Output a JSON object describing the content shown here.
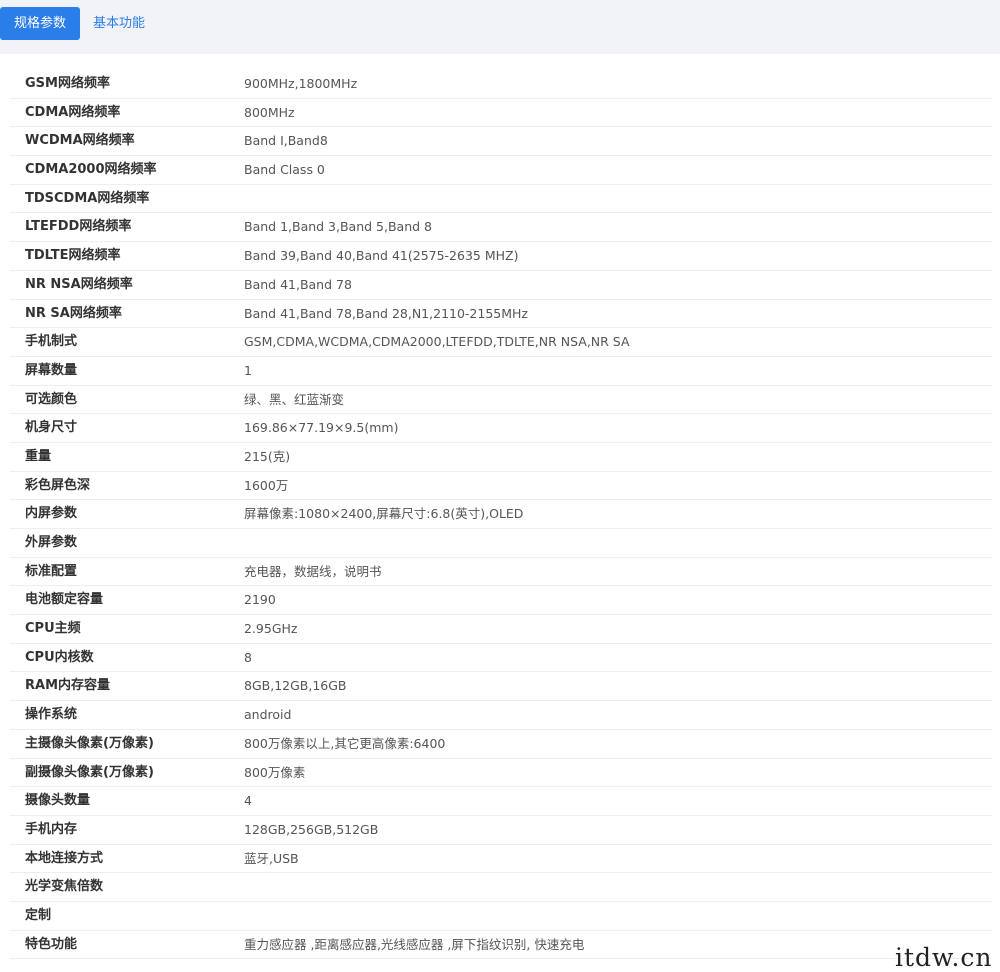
{
  "tabs": [
    {
      "label": "规格参数",
      "active": true
    },
    {
      "label": "基本功能",
      "active": false
    }
  ],
  "specs": [
    {
      "label": "GSM网络频率",
      "value": "900MHz,1800MHz"
    },
    {
      "label": "CDMA网络频率",
      "value": "800MHz"
    },
    {
      "label": "WCDMA网络频率",
      "value": "Band Ⅰ,Band8"
    },
    {
      "label": "CDMA2000网络频率",
      "value": "Band Class 0"
    },
    {
      "label": "TDSCDMA网络频率",
      "value": ""
    },
    {
      "label": "LTEFDD网络频率",
      "value": "Band 1,Band 3,Band 5,Band 8"
    },
    {
      "label": "TDLTE网络频率",
      "value": "Band 39,Band 40,Band 41(2575-2635 MHZ)"
    },
    {
      "label": "NR NSA网络频率",
      "value": "Band 41,Band 78"
    },
    {
      "label": "NR SA网络频率",
      "value": "Band 41,Band 78,Band 28,N1,2110-2155MHz"
    },
    {
      "label": "手机制式",
      "value": "GSM,CDMA,WCDMA,CDMA2000,LTEFDD,TDLTE,NR NSA,NR SA"
    },
    {
      "label": "屏幕数量",
      "value": "1"
    },
    {
      "label": "可选颜色",
      "value": "绿、黑、红蓝渐变"
    },
    {
      "label": "机身尺寸",
      "value": "169.86×77.19×9.5(mm)"
    },
    {
      "label": "重量",
      "value": "215(克)"
    },
    {
      "label": "彩色屏色深",
      "value": "1600万"
    },
    {
      "label": "内屏参数",
      "value": "屏幕像素:1080×2400,屏幕尺寸:6.8(英寸),OLED"
    },
    {
      "label": "外屏参数",
      "value": ""
    },
    {
      "label": "标准配置",
      "value": "充电器，数据线，说明书"
    },
    {
      "label": "电池额定容量",
      "value": "2190"
    },
    {
      "label": "CPU主频",
      "value": "2.95GHz"
    },
    {
      "label": "CPU内核数",
      "value": "8"
    },
    {
      "label": "RAM内存容量",
      "value": "8GB,12GB,16GB"
    },
    {
      "label": "操作系统",
      "value": "android"
    },
    {
      "label": "主摄像头像素(万像素)",
      "value": "800万像素以上,其它更高像素:6400"
    },
    {
      "label": "副摄像头像素(万像素)",
      "value": "800万像素"
    },
    {
      "label": "摄像头数量",
      "value": "4"
    },
    {
      "label": "手机内存",
      "value": "128GB,256GB,512GB"
    },
    {
      "label": "本地连接方式",
      "value": "蓝牙,USB"
    },
    {
      "label": "光学变焦倍数",
      "value": ""
    },
    {
      "label": "定制",
      "value": ""
    },
    {
      "label": "特色功能",
      "value": "重力感应器 ,距离感应器,光线感应器 ,屏下指纹识别, 快速充电"
    }
  ],
  "watermark": "itdw.cn",
  "colors": {
    "accent": "#2b7de9",
    "tabbar_bg": "#f1f3f6",
    "row_divider": "#eceef1"
  }
}
